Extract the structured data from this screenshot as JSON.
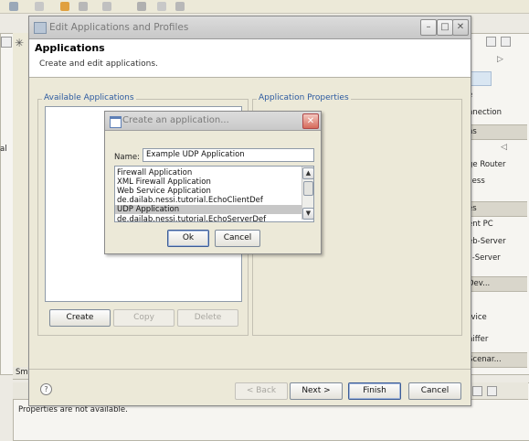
{
  "main_dialog": {
    "title": "Edit Applications and Profiles",
    "banner_title": "Applications",
    "banner_subtitle": "Create and edit applications.",
    "available_label": "Available Applications",
    "properties_label": "Application Properties",
    "create_label": "Create",
    "copy_label": "Copy",
    "delete_label": "Delete",
    "help_glyph": "?",
    "back_label": "< Back",
    "next_label": "Next >",
    "finish_label": "Finish",
    "cancel_label": "Cancel"
  },
  "sub_dialog": {
    "title": "Create an application...",
    "name_label": "Name:",
    "name_value": "Example UDP Application",
    "items": [
      "Firewall Application",
      "XML Firewall Application",
      "Web Service Application",
      "de.dailab.nessi.tutorial.EchoClientDef",
      "UDP Application",
      "de.dailab.nessi.tutorial.EchoServerDef"
    ],
    "selected_index": 4,
    "ok_label": "Ok",
    "cancel_label": "Cancel"
  },
  "background": {
    "right_items": [
      "e",
      "nnection",
      "ns",
      "ge Router",
      "cess",
      "es",
      "ent PC",
      "eb-Server",
      "il-Server",
      "Dev...",
      "rvice",
      "niffer",
      "Scenar..."
    ],
    "bottom_status": "Properties are not available.",
    "left_tab": "Sm",
    "left_letter": "al"
  },
  "colors": {
    "group_label": "#2c5aa0",
    "selection": "#c7c7c7",
    "close_button": "#d66a5a"
  }
}
